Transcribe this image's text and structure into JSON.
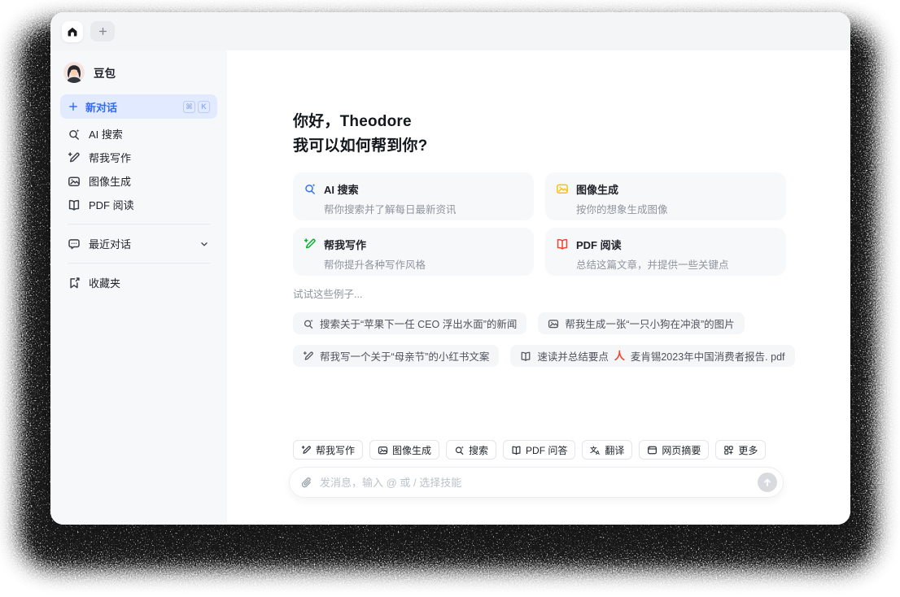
{
  "app": {
    "name": "豆包"
  },
  "tabbar": {
    "tabs": [
      {
        "icon": "home-icon"
      },
      {
        "icon": "plus-icon"
      }
    ]
  },
  "sidebar": {
    "profile_name": "豆包",
    "new_chat": {
      "label": "新对话",
      "icon": "plus-icon",
      "shortcut": [
        "⌘",
        "K"
      ]
    },
    "items": [
      {
        "icon": "ai-search-icon",
        "label": "AI 搜索"
      },
      {
        "icon": "write-icon",
        "label": "帮我写作"
      },
      {
        "icon": "image-icon",
        "label": "图像生成"
      },
      {
        "icon": "book-icon",
        "label": "PDF 阅读"
      }
    ],
    "recent": {
      "icon": "chat-bubble-icon",
      "label": "最近对话",
      "chevron": "chevron-down-icon"
    },
    "favorites": {
      "icon": "bookmark-icon",
      "label": "收藏夹"
    }
  },
  "main": {
    "greeting_line1": "你好，Theodore",
    "greeting_line2": "我可以如何帮到你?",
    "cards": [
      {
        "icon": "search-icon",
        "color": "#3370FF",
        "title": "AI 搜索",
        "desc": "帮你搜索并了解每日最新资讯"
      },
      {
        "icon": "image-icon",
        "color": "#F7C116",
        "title": "图像生成",
        "desc": "按你的想象生成图像"
      },
      {
        "icon": "write-icon",
        "color": "#00B42A",
        "title": "帮我写作",
        "desc": "帮你提升各种写作风格"
      },
      {
        "icon": "book-icon",
        "color": "#F5432E",
        "title": "PDF 阅读",
        "desc": "总结这篇文章，并提供一些关键点"
      }
    ],
    "examples_title": "试试这些例子...",
    "examples": [
      {
        "icon": "search-icon",
        "text": "搜索关于“苹果下一任 CEO 浮出水面”的新闻"
      },
      {
        "icon": "image-icon",
        "text": "帮我生成一张“一只小狗在冲浪”的图片"
      },
      {
        "icon": "write-icon",
        "text": "帮我写一个关于“母亲节”的小红书文案"
      },
      {
        "icon": "book-icon",
        "text": "速读并总结要点",
        "attachment_icon": "pdf-file-icon",
        "attachment_mark": "人",
        "attachment": "麦肯锡2023年中国消费者报告. pdf"
      }
    ],
    "skills": [
      {
        "icon": "write-icon",
        "label": "帮我写作"
      },
      {
        "icon": "image-icon",
        "label": "图像生成"
      },
      {
        "icon": "search-icon",
        "label": "搜索"
      },
      {
        "icon": "book-icon",
        "label": "PDF 问答"
      },
      {
        "icon": "translate-icon",
        "label": "翻译"
      },
      {
        "icon": "web-icon",
        "label": "网页摘要"
      },
      {
        "icon": "more-icon",
        "label": "更多"
      }
    ],
    "composer": {
      "attach_icon": "paperclip-icon",
      "placeholder": "发消息，输入 @ 或 / 选择技能",
      "send_icon": "arrow-up-icon"
    }
  },
  "colors": {
    "accent_blue": "#336DF4",
    "new_chat_bg": "#E1EAFF",
    "sidebar_bg": "#F7F8FA",
    "tabbar_bg": "#F4F5F7",
    "card_bg": "#F7F8FA",
    "chip_bg": "#F4F6F8",
    "search_blue": "#3370FF",
    "image_yellow": "#F7C116",
    "write_green": "#00B42A",
    "pdf_red": "#F5432E",
    "send_btn_gray": "#D8DADE"
  }
}
